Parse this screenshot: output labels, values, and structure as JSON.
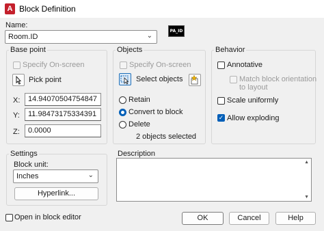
{
  "window": {
    "title": "Block Definition",
    "app_icon": "A"
  },
  "name": {
    "label": "Name:",
    "value": "Room.ID",
    "preview_text": "PA_ID"
  },
  "base_point": {
    "title": "Base point",
    "specify_on_screen": "Specify On-screen",
    "pick_point": "Pick point",
    "x_label": "X:",
    "x_value": "14.94070504754847",
    "y_label": "Y:",
    "y_value": "11.98473175334391",
    "z_label": "Z:",
    "z_value": "0.0000"
  },
  "objects": {
    "title": "Objects",
    "specify_on_screen": "Specify On-screen",
    "select_objects": "Select objects",
    "retain": "Retain",
    "convert": "Convert to block",
    "delete": "Delete",
    "status": "2 objects selected",
    "selected_option": "Convert to block"
  },
  "behavior": {
    "title": "Behavior",
    "annotative": "Annotative",
    "match_orientation": "Match block orientation\nto layout",
    "scale_uniformly": "Scale uniformly",
    "allow_exploding": "Allow exploding",
    "allow_exploding_checked": true
  },
  "settings": {
    "title": "Settings",
    "block_unit_label": "Block unit:",
    "block_unit_value": "Inches",
    "hyperlink": "Hyperlink..."
  },
  "description": {
    "title": "Description",
    "value": ""
  },
  "footer": {
    "open_in_editor": "Open in block editor",
    "ok": "OK",
    "cancel": "Cancel",
    "help": "Help"
  },
  "colors": {
    "accent": "#005fb8",
    "app_red": "#c4202c"
  }
}
